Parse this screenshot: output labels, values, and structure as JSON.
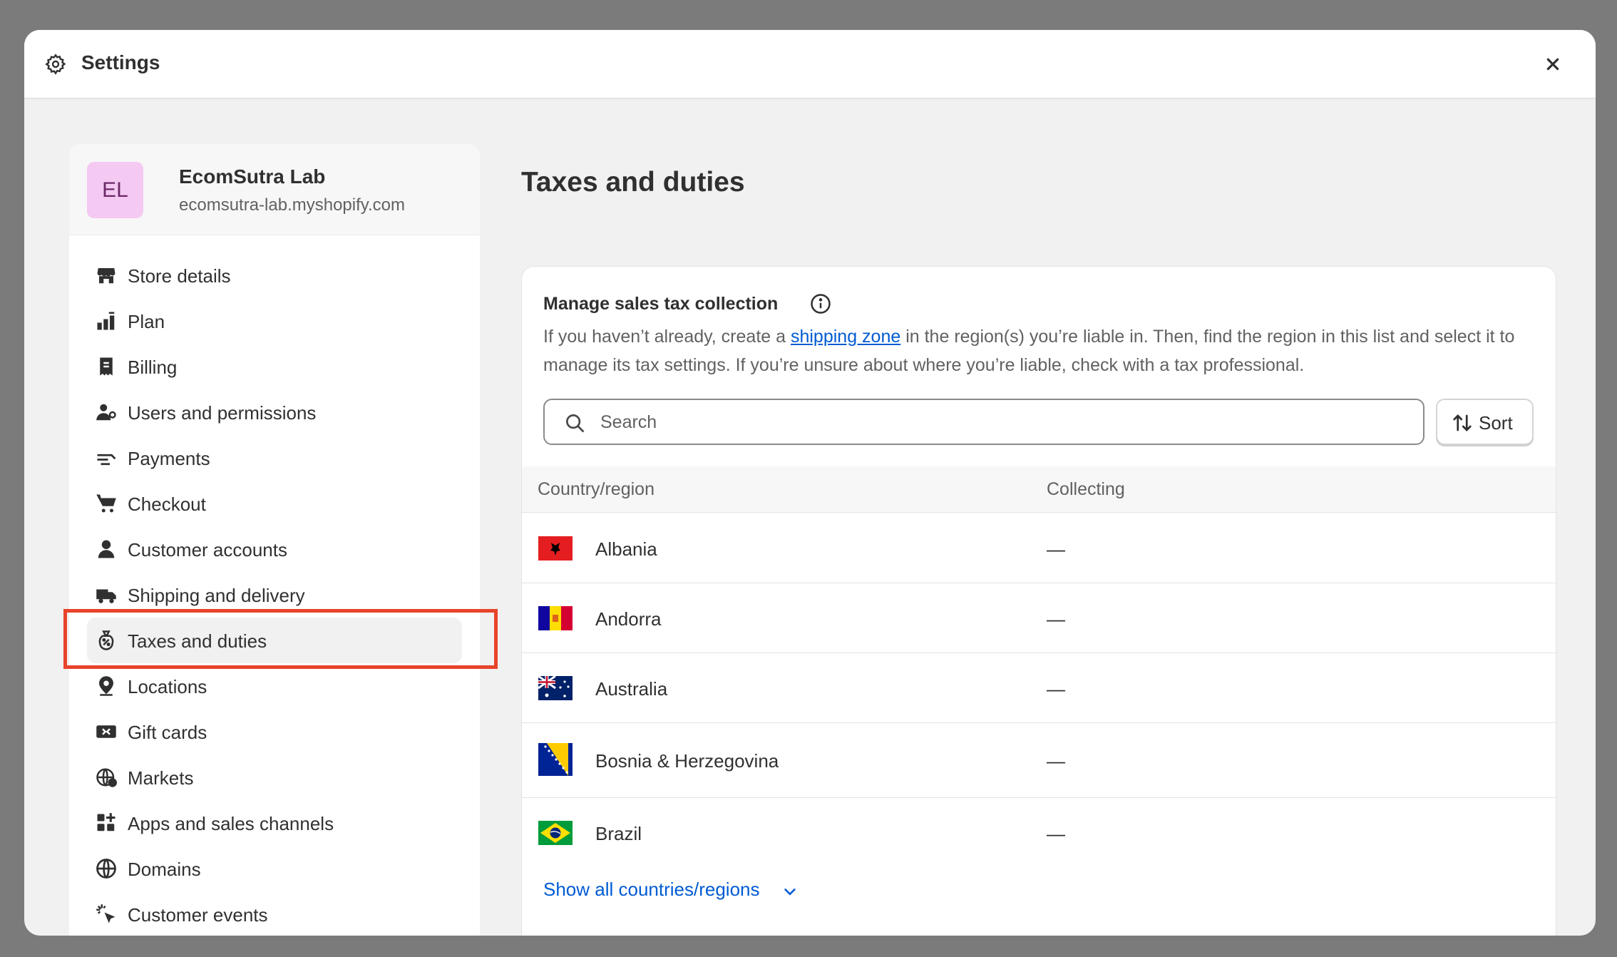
{
  "header": {
    "title": "Settings",
    "icons": {
      "settings": "gear-icon",
      "close": "close-icon"
    }
  },
  "store": {
    "initials": "EL",
    "name": "EcomSutra Lab",
    "url": "ecomsutra-lab.myshopify.com"
  },
  "sidebar": {
    "items": [
      {
        "label": "Store details",
        "icon": "store-icon"
      },
      {
        "label": "Plan",
        "icon": "plan-icon"
      },
      {
        "label": "Billing",
        "icon": "billing-icon"
      },
      {
        "label": "Users and permissions",
        "icon": "users-icon"
      },
      {
        "label": "Payments",
        "icon": "payments-icon"
      },
      {
        "label": "Checkout",
        "icon": "cart-icon"
      },
      {
        "label": "Customer accounts",
        "icon": "person-icon"
      },
      {
        "label": "Shipping and delivery",
        "icon": "truck-icon"
      },
      {
        "label": "Taxes and duties",
        "icon": "tax-icon",
        "active": true
      },
      {
        "label": "Locations",
        "icon": "location-icon"
      },
      {
        "label": "Gift cards",
        "icon": "gift-card-icon"
      },
      {
        "label": "Markets",
        "icon": "globe-currency-icon"
      },
      {
        "label": "Apps and sales channels",
        "icon": "apps-icon"
      },
      {
        "label": "Domains",
        "icon": "globe-icon"
      },
      {
        "label": "Customer events",
        "icon": "cursor-click-icon"
      }
    ]
  },
  "main": {
    "title": "Taxes and duties",
    "card": {
      "heading": "Manage sales tax collection",
      "desc_before": "If you haven’t already, create a ",
      "desc_link": "shipping zone",
      "desc_after": " in the region(s) you’re liable in. Then, find the region in this list and select it to manage its tax settings. If you’re unsure about where you’re liable, check with a tax professional.",
      "search_placeholder": "Search",
      "sort_label": "Sort",
      "columns": [
        "Country/region",
        "Collecting"
      ],
      "rows": [
        {
          "country": "Albania",
          "collecting": "—",
          "flag": "albania-flag"
        },
        {
          "country": "Andorra",
          "collecting": "—",
          "flag": "andorra-flag"
        },
        {
          "country": "Australia",
          "collecting": "—",
          "flag": "australia-flag"
        },
        {
          "country": "Bosnia & Herzegovina",
          "collecting": "—",
          "flag": "bosnia-flag"
        },
        {
          "country": "Brazil",
          "collecting": "—",
          "flag": "brazil-flag"
        }
      ],
      "show_all": "Show all countries/regions"
    }
  },
  "colors": {
    "accent_link": "#005bd3",
    "highlight": "#e8432a",
    "avatar_bg": "#f4c9f2"
  }
}
